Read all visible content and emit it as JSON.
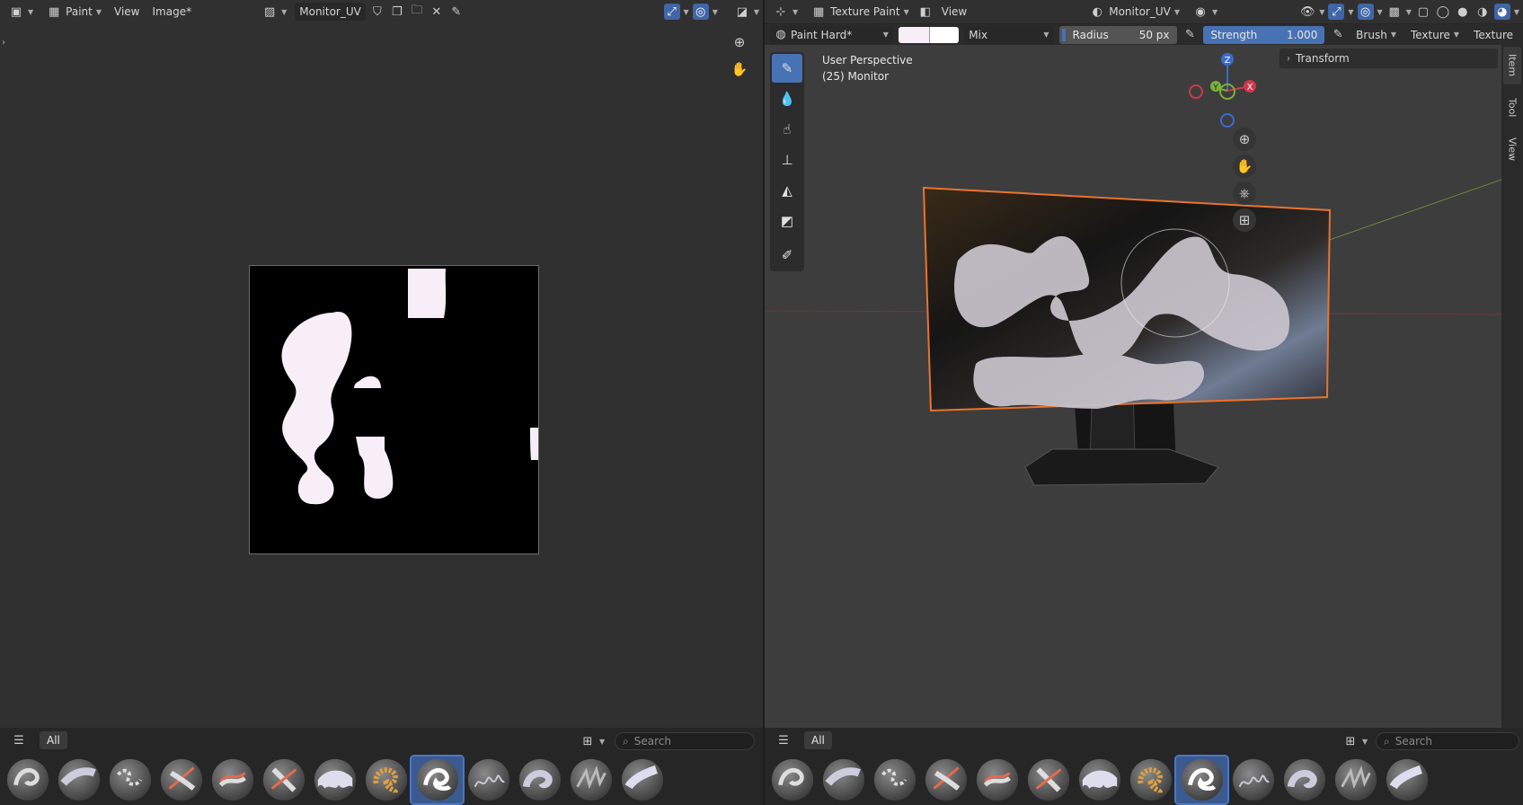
{
  "left_editor": {
    "mode_label": "Paint",
    "menu_view": "View",
    "menu_image": "Image*",
    "image_name": "Monitor_UV",
    "tab_all": "All",
    "search_placeholder": "Search"
  },
  "right_editor": {
    "mode_label": "Texture Paint",
    "menu_view": "View",
    "image_name": "Monitor_UV",
    "brush_name": "Paint Hard*",
    "blend_mode": "Mix",
    "radius_label": "Radius",
    "radius_value": "50 px",
    "strength_label": "Strength",
    "strength_value": "1.000",
    "brush_menu": "Brush",
    "texture_menu": "Texture",
    "texture_menu_2": "Texture",
    "viewport_title": "User Perspective",
    "viewport_object": "(25) Monitor",
    "npanel_header": "Transform",
    "side_tabs": [
      "Item",
      "Tool",
      "View"
    ],
    "gizmo_axes": {
      "z": "Z",
      "y": "Y",
      "x": "X"
    },
    "tab_all": "All",
    "search_placeholder": "Search"
  },
  "colors": {
    "primary_color": "#f7eef8",
    "secondary_color": "#ffffff",
    "accent": "#4772b3",
    "selection_outline": "#e8742d"
  },
  "brush_presets_selected_index": 8
}
